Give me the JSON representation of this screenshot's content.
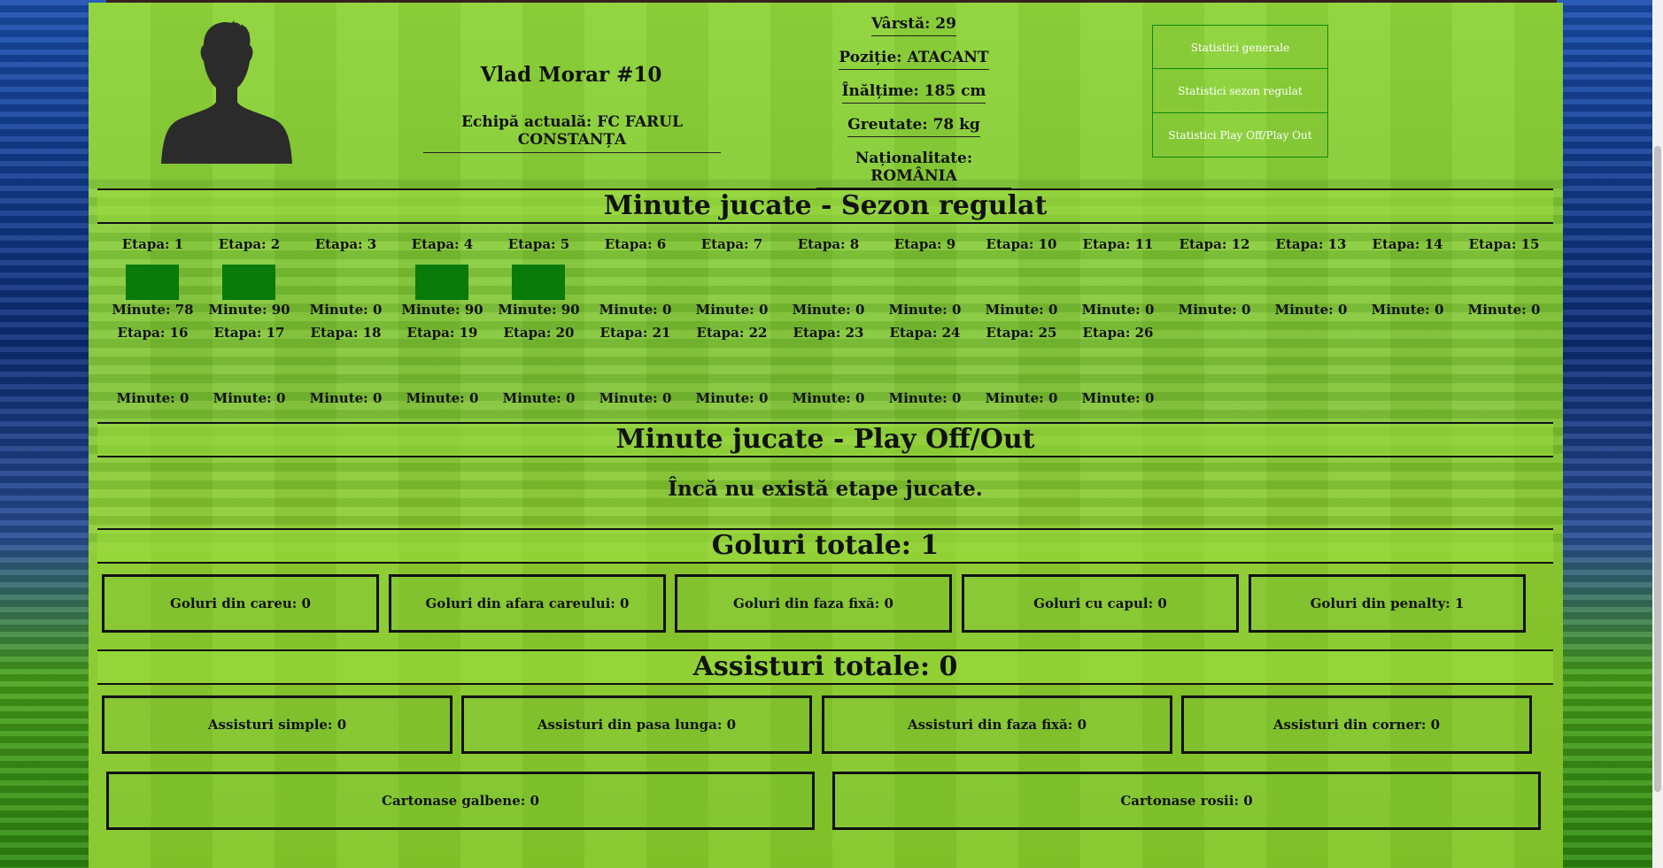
{
  "player": {
    "name": "Vlad Morar #10",
    "team": "Echipă actuală: FC FARUL CONSTANȚA",
    "info": [
      "Vârstă: 29",
      "Poziție: ATACANT",
      "Înălțime: 185 cm",
      "Greutate: 78 kg",
      "Naționalitate: ROMÂNIA"
    ]
  },
  "menu": [
    "Statistici generale",
    "Statistici sezon regulat",
    "Statistici Play Off/Play Out"
  ],
  "regular_season": {
    "title": "Minute jucate - Sezon regulat",
    "row1_rounds": [
      "Etapa: 1",
      "Etapa: 2",
      "Etapa: 3",
      "Etapa: 4",
      "Etapa: 5",
      "Etapa: 6",
      "Etapa: 7",
      "Etapa: 8",
      "Etapa: 9",
      "Etapa: 10",
      "Etapa: 11",
      "Etapa: 12",
      "Etapa: 13",
      "Etapa: 14",
      "Etapa: 15"
    ],
    "row1_minutes": [
      "Minute: 78",
      "Minute: 90",
      "Minute: 0",
      "Minute: 90",
      "Minute: 90",
      "Minute: 0",
      "Minute: 0",
      "Minute: 0",
      "Minute: 0",
      "Minute: 0",
      "Minute: 0",
      "Minute: 0",
      "Minute: 0",
      "Minute: 0",
      "Minute: 0"
    ],
    "row1_played": [
      true,
      true,
      false,
      true,
      true,
      false,
      false,
      false,
      false,
      false,
      false,
      false,
      false,
      false,
      false
    ],
    "row2_rounds": [
      "Etapa: 16",
      "Etapa: 17",
      "Etapa: 18",
      "Etapa: 19",
      "Etapa: 20",
      "Etapa: 21",
      "Etapa: 22",
      "Etapa: 23",
      "Etapa: 24",
      "Etapa: 25",
      "Etapa: 26"
    ],
    "row2_minutes": [
      "Minute: 0",
      "Minute: 0",
      "Minute: 0",
      "Minute: 0",
      "Minute: 0",
      "Minute: 0",
      "Minute: 0",
      "Minute: 0",
      "Minute: 0",
      "Minute: 0",
      "Minute: 0"
    ]
  },
  "playoff": {
    "title": "Minute jucate - Play Off/Out",
    "message": "Încă nu există etape jucate."
  },
  "goals": {
    "title": "Goluri totale: 1",
    "items": [
      "Goluri din careu: 0",
      "Goluri din afara careului: 0",
      "Goluri din faza fixă: 0",
      "Goluri cu capul: 0",
      "Goluri din penalty: 1"
    ]
  },
  "assists": {
    "title": "Assisturi totale: 0",
    "items": [
      "Assisturi simple: 0",
      "Assisturi din pasa lunga: 0",
      "Assisturi din faza fixă: 0",
      "Assisturi din corner: 0"
    ]
  },
  "cards": {
    "items": [
      "Cartonase galbene: 0",
      "Cartonase rosii: 0"
    ]
  },
  "colors": {
    "bar": "#0a7a0a",
    "menu_border": "#0c8a0c"
  }
}
